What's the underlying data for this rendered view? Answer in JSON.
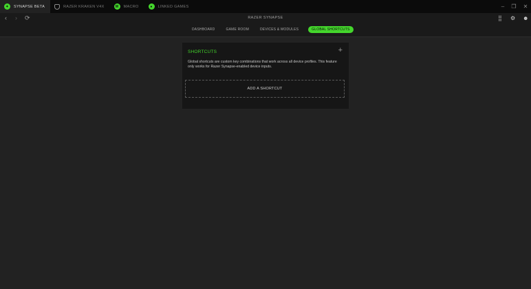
{
  "tabs": [
    {
      "label": "SYNAPSE BETA",
      "icon": "razer-icon"
    },
    {
      "label": "RAZER KRAKEN V4X",
      "icon": "headset-icon"
    },
    {
      "label": "MACRO",
      "icon": "macro-icon",
      "badge": "M"
    },
    {
      "label": "LINKED GAMES",
      "icon": "gamepad-icon"
    }
  ],
  "app": {
    "title": "RAZER SYNAPSE"
  },
  "subnav": [
    {
      "label": "DASHBOARD"
    },
    {
      "label": "GAME ROOM"
    },
    {
      "label": "DEVICES & MODULES"
    },
    {
      "label": "GLOBAL SHORTCUTS"
    }
  ],
  "shortcuts": {
    "title": "SHORTCUTS",
    "description": "Global shortcuts are custom key combinations that work across all device profiles. This feature only works for Razer Synapse-enabled device inputs.",
    "add_label": "ADD A SHORTCUT"
  },
  "colors": {
    "accent": "#44d62c",
    "background": "#222222",
    "card": "#161616"
  }
}
